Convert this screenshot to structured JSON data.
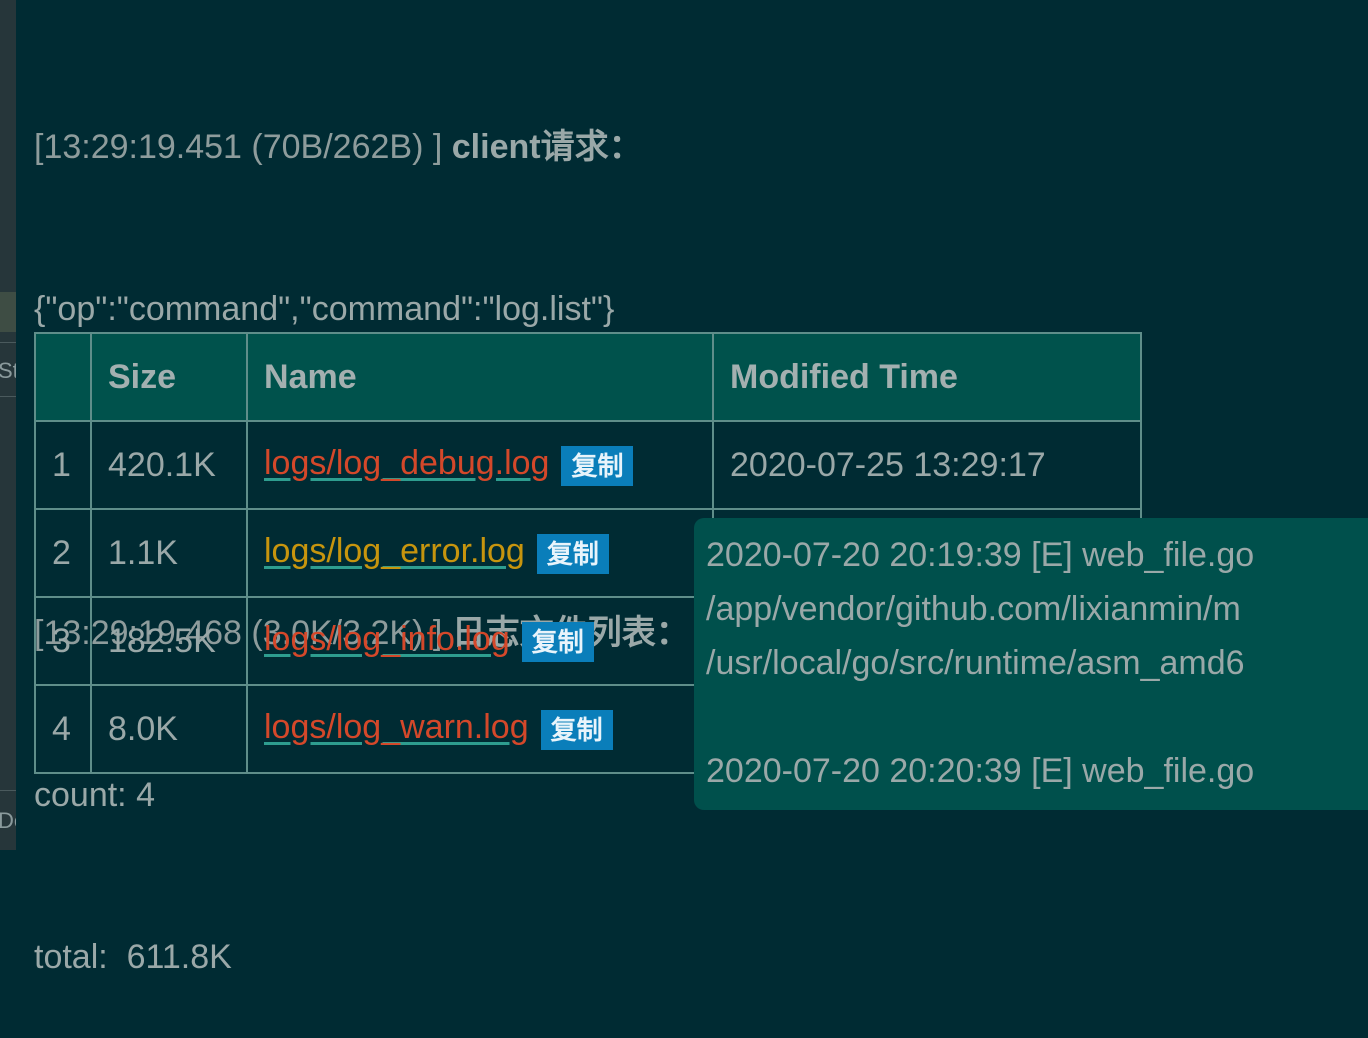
{
  "sidebar": {
    "fragment_1": "St",
    "fragment_2": "De"
  },
  "log": {
    "entry1": {
      "timestamp": "[13:29:19.451 (70B/262B) ]",
      "title": "client请求：",
      "body": "{\"op\":\"command\",\"command\":\"log.list\"}"
    },
    "entry2": {
      "timestamp": "[13:29:19.468 (3.0K/3.2K) ]",
      "title": "日志文件列表：",
      "count_line": "count: 4",
      "total_line": "total:  611.8K"
    }
  },
  "table": {
    "headers": {
      "index": "",
      "size": "Size",
      "name": "Name",
      "modified": "Modified Time"
    },
    "rows": [
      {
        "index": "1",
        "size": "420.1K",
        "name": "logs/log_debug.log",
        "copy": "复制",
        "modified": "2020-07-25 13:29:17"
      },
      {
        "index": "2",
        "size": "1.1K",
        "name": "logs/log_error.log",
        "copy": "复制",
        "modified": ""
      },
      {
        "index": "3",
        "size": "182.5K",
        "name": "logs/log_info.log",
        "copy": "复制",
        "modified": ""
      },
      {
        "index": "4",
        "size": "8.0K",
        "name": "logs/log_warn.log",
        "copy": "复制",
        "modified": ""
      }
    ]
  },
  "tooltip": {
    "lines": [
      "2020-07-20 20:19:39 [E] web_file.go",
      "/app/vendor/github.com/lixianmin/m",
      "/usr/local/go/src/runtime/asm_amd6",
      "",
      "2020-07-20 20:20:39 [E] web_file.go"
    ]
  },
  "colors": {
    "background": "#002b33",
    "table_header": "#00524c",
    "link_red": "#d4482a",
    "link_yellow": "#c7950e",
    "copy_button": "#0a7eba",
    "tooltip_bg": "#00504c"
  }
}
